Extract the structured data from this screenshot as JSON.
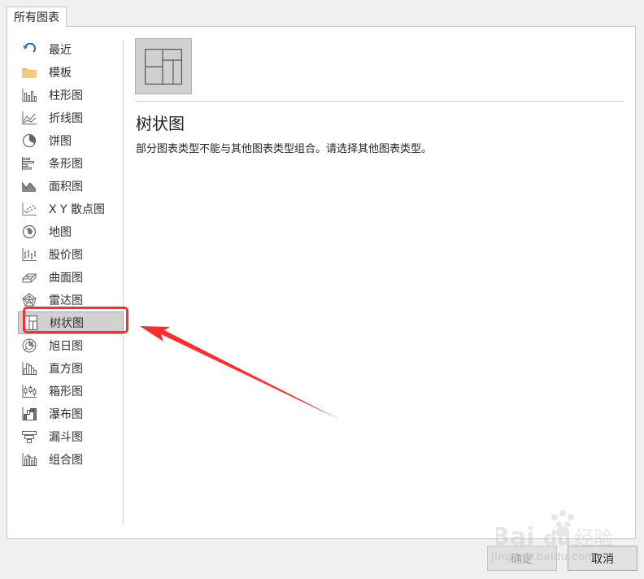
{
  "tab_label": "所有图表",
  "sidebar": {
    "items": [
      {
        "label": "最近",
        "icon": "recent-icon"
      },
      {
        "label": "模板",
        "icon": "folder-icon"
      },
      {
        "label": "柱形图",
        "icon": "column-chart-icon"
      },
      {
        "label": "折线图",
        "icon": "line-chart-icon"
      },
      {
        "label": "饼图",
        "icon": "pie-chart-icon"
      },
      {
        "label": "条形图",
        "icon": "bar-chart-icon"
      },
      {
        "label": "面积图",
        "icon": "area-chart-icon"
      },
      {
        "label": "X Y 散点图",
        "icon": "scatter-chart-icon"
      },
      {
        "label": "地图",
        "icon": "map-chart-icon"
      },
      {
        "label": "股价图",
        "icon": "stock-chart-icon"
      },
      {
        "label": "曲面图",
        "icon": "surface-chart-icon"
      },
      {
        "label": "雷达图",
        "icon": "radar-chart-icon"
      },
      {
        "label": "树状图",
        "icon": "treemap-chart-icon",
        "selected": true
      },
      {
        "label": "旭日图",
        "icon": "sunburst-chart-icon"
      },
      {
        "label": "直方图",
        "icon": "histogram-chart-icon"
      },
      {
        "label": "箱形图",
        "icon": "box-whisker-chart-icon"
      },
      {
        "label": "瀑布图",
        "icon": "waterfall-chart-icon"
      },
      {
        "label": "漏斗图",
        "icon": "funnel-chart-icon"
      },
      {
        "label": "组合图",
        "icon": "combo-chart-icon"
      }
    ]
  },
  "main": {
    "title": "树状图",
    "description": "部分图表类型不能与其他图表类型组合。请选择其他图表类型。"
  },
  "buttons": {
    "ok_label": "确定",
    "cancel_label": "取消"
  },
  "watermark": {
    "logo_text": "Bai du 经验",
    "url_text": "jingyan.baidu.com"
  },
  "colors": {
    "annotation_red": "#ff2d2d",
    "selected_bg": "#d1d1d1",
    "icon_gray": "#666666",
    "recent_blue": "#2e6fbf",
    "folder_yellow": "#e8c36a"
  }
}
